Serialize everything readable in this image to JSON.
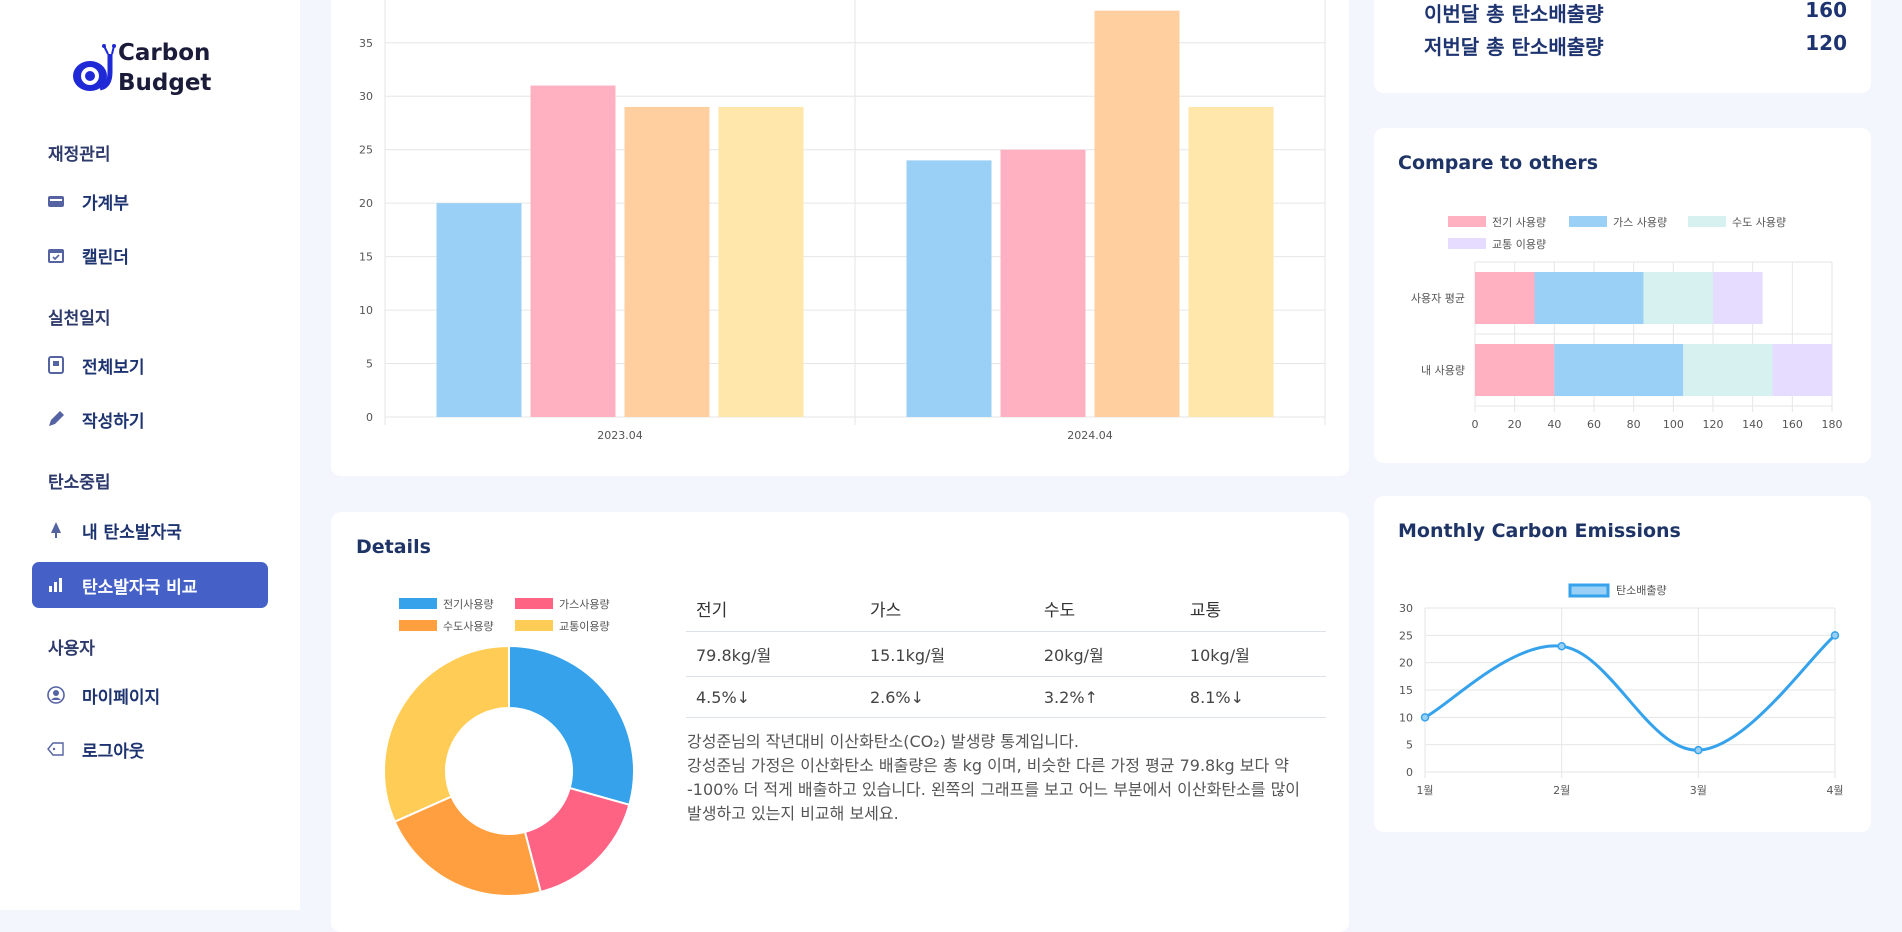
{
  "brand": {
    "line1": "Carbon",
    "line2": "Budget"
  },
  "sidebar": {
    "sections": [
      {
        "title": "재정관리"
      },
      {
        "title": "실천일지"
      },
      {
        "title": "탄소중립"
      },
      {
        "title": "사용자"
      }
    ],
    "items": [
      {
        "label": "가계부",
        "icon": "wallet-icon"
      },
      {
        "label": "캘린더",
        "icon": "calendar-icon"
      },
      {
        "label": "전체보기",
        "icon": "notebook-icon"
      },
      {
        "label": "작성하기",
        "icon": "pen-icon"
      },
      {
        "label": "내 탄소발자국",
        "icon": "tree-icon"
      },
      {
        "label": "탄소발자국 비교",
        "icon": "bar-chart-icon",
        "active": true
      },
      {
        "label": "마이페이지",
        "icon": "user-circle-icon"
      },
      {
        "label": "로그아웃",
        "icon": "logout-icon"
      }
    ]
  },
  "summary": {
    "rows": [
      {
        "label": "이번달 총 탄소배출량",
        "value": "160"
      },
      {
        "label": "저번달 총 탄소배출량",
        "value": "120"
      }
    ]
  },
  "colors": {
    "accent": "#4561c8",
    "blue": "#36a2eb",
    "pink": "#ff6384",
    "orange": "#ff9f40",
    "yellow": "#ffcd56",
    "teal": "#4bc0c0",
    "purple": "#9966ff"
  },
  "chart_data": [
    {
      "type": "bar",
      "categories": [
        "2023.04",
        "2024.04"
      ],
      "series": [
        {
          "values": [
            20,
            24
          ],
          "color": "#9ad0f5"
        },
        {
          "values": [
            31,
            25
          ],
          "color": "#ffb1c1"
        },
        {
          "values": [
            29,
            38
          ],
          "color": "#ffcf9f"
        },
        {
          "values": [
            29,
            29
          ],
          "color": "#ffe6aa"
        }
      ],
      "ylim": [
        0,
        39
      ],
      "yticks": [
        0,
        5,
        10,
        15,
        20,
        25,
        30,
        35
      ],
      "grid": true
    },
    {
      "type": "bar",
      "orientation": "horizontal",
      "stacked": true,
      "title": "Compare to others",
      "categories": [
        "사용자 평균",
        "내 사용량"
      ],
      "series": [
        {
          "name": "전기 사용량",
          "values": [
            30,
            40
          ],
          "color": "#ffb1c1"
        },
        {
          "name": "가스 사용량",
          "values": [
            55,
            65
          ],
          "color": "#9ad0f5"
        },
        {
          "name": "수도 사용량",
          "values": [
            35,
            45
          ],
          "color": "#d6f1f0"
        },
        {
          "name": "교통 이용량",
          "values": [
            25,
            30
          ],
          "color": "#e6dcff"
        }
      ],
      "xlim": [
        0,
        180
      ],
      "xticks": [
        0,
        20,
        40,
        60,
        80,
        100,
        120,
        140,
        160,
        180
      ],
      "legend": "top"
    },
    {
      "type": "line",
      "title": "Monthly Carbon Emissions",
      "x": [
        "1월",
        "2월",
        "3월",
        "4월"
      ],
      "series": [
        {
          "name": "탄소배출량",
          "values": [
            10,
            23,
            4,
            25
          ],
          "color": "#36a2eb"
        }
      ],
      "ylim": [
        0,
        30
      ],
      "yticks": [
        0,
        5,
        10,
        15,
        20,
        25,
        30
      ],
      "legend": "top"
    },
    {
      "type": "pie",
      "donut": true,
      "title": "Details",
      "categories": [
        "전기사용량",
        "가스사용량",
        "수도사용량",
        "교통이용량"
      ],
      "values": [
        79.8,
        45,
        61,
        86
      ],
      "colors": [
        "#36a2eb",
        "#ff6384",
        "#ff9f40",
        "#ffcd56"
      ],
      "legend": "top"
    }
  ],
  "details": {
    "headers": [
      "전기",
      "가스",
      "수도",
      "교통"
    ],
    "rows": [
      [
        "79.8kg/월",
        "15.1kg/월",
        "20kg/월",
        "10kg/월"
      ],
      [
        "4.5%↓",
        "2.6%↓",
        "3.2%↑",
        "8.1%↓"
      ]
    ],
    "desc_line1": "강성준님의 작년대비 이산화탄소(CO₂) 발생량 통계입니다.",
    "desc_line2": "강성준님 가정은 이산화탄소 배출량은 총 kg 이며, 비슷한 다른 가정 평균 79.8kg 보다 약 -100% 더 적게 배출하고 있습니다. 왼쪽의 그래프를 보고 어느 부분에서 이산화탄소를 많이 발생하고 있는지 비교해 보세요."
  }
}
